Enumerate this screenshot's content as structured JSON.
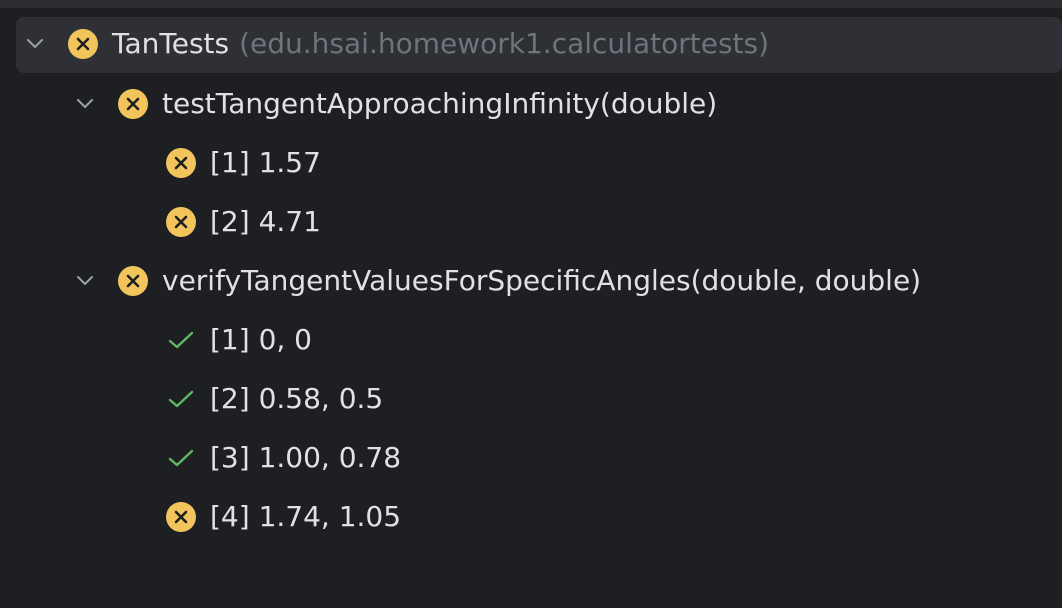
{
  "tree": {
    "root": {
      "name": "TanTests",
      "package": "(edu.hsai.homework1.calculatortests)",
      "status": "failed",
      "expanded": true
    },
    "methods": [
      {
        "name": "testTangentApproachingInfinity(double)",
        "status": "failed",
        "expanded": true,
        "cases": [
          {
            "label": "[1] 1.57",
            "status": "failed"
          },
          {
            "label": "[2] 4.71",
            "status": "failed"
          }
        ]
      },
      {
        "name": "verifyTangentValuesForSpecificAngles(double, double)",
        "status": "failed",
        "expanded": true,
        "cases": [
          {
            "label": "[1] 0, 0",
            "status": "passed"
          },
          {
            "label": "[2] 0.58, 0.5",
            "status": "passed"
          },
          {
            "label": "[3] 1.00, 0.78",
            "status": "passed"
          },
          {
            "label": "[4] 1.74, 1.05",
            "status": "failed"
          }
        ]
      }
    ]
  },
  "icons": {
    "failed": "failed-x-icon",
    "passed": "passed-check-icon",
    "expand": "chevron-down-icon"
  },
  "colors": {
    "background": "#1e1f22",
    "selected_row": "#2e3035",
    "failed_icon": "#f2c55c",
    "passed_check": "#5fb865",
    "text": "#dfe1e5",
    "package_text": "#6f737a"
  }
}
